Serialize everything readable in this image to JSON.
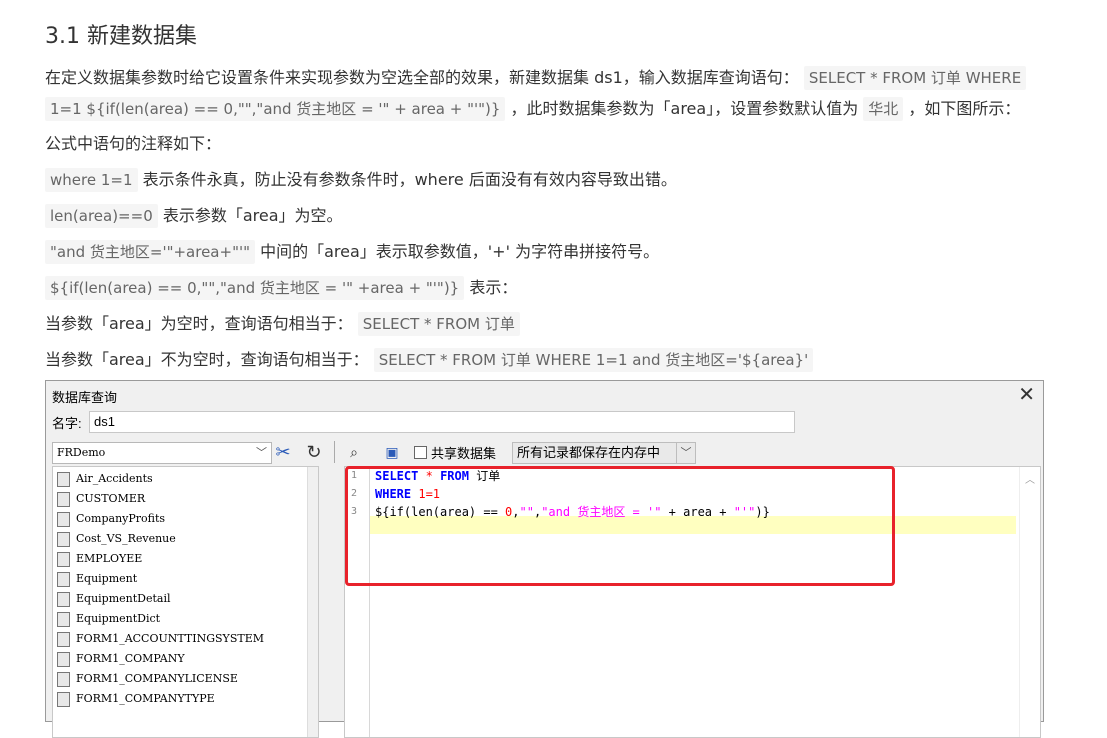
{
  "heading": "3.1 新建数据集",
  "p1": {
    "t1": "在定义数据集参数时给它设置条件来实现参数为空选全部的效果，新建数据集 ds1，输入数据库查询语句：",
    "c1": "SELECT * FROM 订单  WHERE",
    "c2": "1=1  ${if(len(area) == 0,\"\",\"and 货主地区 = '\" + area + \"'\")}",
    "t2": "，此时数据集参数为「area」，设置参数默认值为",
    "c3": "华北",
    "t3": "，如下图所示："
  },
  "p2": "公式中语句的注释如下：",
  "p3": {
    "c": "where 1=1",
    "t": "表示条件永真，防止没有参数条件时，where 后面没有有效内容导致出错。"
  },
  "p4": {
    "c": "len(area)==0",
    "t": "表示参数「area」为空。"
  },
  "p5": {
    "c": "\"and 货主地区='\"+area+\"'\"",
    "t": "中间的「area」表示取参数值，'+' 为字符串拼接符号。"
  },
  "p6": {
    "c": "${if(len(area) == 0,\"\",\"and 货主地区 = '\" +area + \"'\")}",
    "t": "表示："
  },
  "p7": {
    "t": "当参数「area」为空时，查询语句相当于：",
    "c": "SELECT * FROM 订单"
  },
  "p8": {
    "t": "当参数「area」不为空时，查询语句相当于：",
    "c": "SELECT * FROM 订单 WHERE 1=1 and 货主地区='${area}'"
  },
  "dialog": {
    "title": "数据库查询",
    "close": "✕",
    "name_label": "名字:",
    "name_value": "ds1",
    "datasource": "FRDemo",
    "share_label": "共享数据集",
    "memory_option": "所有记录都保存在内存中",
    "tables": [
      "Air_Accidents",
      "CUSTOMER",
      "CompanyProfits",
      "Cost_VS_Revenue",
      "EMPLOYEE",
      "Equipment",
      "EquipmentDetail",
      "EquipmentDict",
      "FORM1_ACCOUNTTINGSYSTEM",
      "FORM1_COMPANY",
      "FORM1_COMPANYLICENSE",
      "FORM1_COMPANYTYPE"
    ],
    "line_numbers": [
      "1",
      "2",
      "3"
    ]
  },
  "icons": [
    "dropdown-arrow-icon",
    "tools-icon",
    "refresh-icon",
    "preview-icon",
    "save-icon",
    "scroll-up-icon"
  ],
  "colors": {
    "keyword": "#0000ff",
    "string": "#ff00ff",
    "number": "#ff0000",
    "highlight": "#ffffc0",
    "annotation": "#e8222b"
  }
}
